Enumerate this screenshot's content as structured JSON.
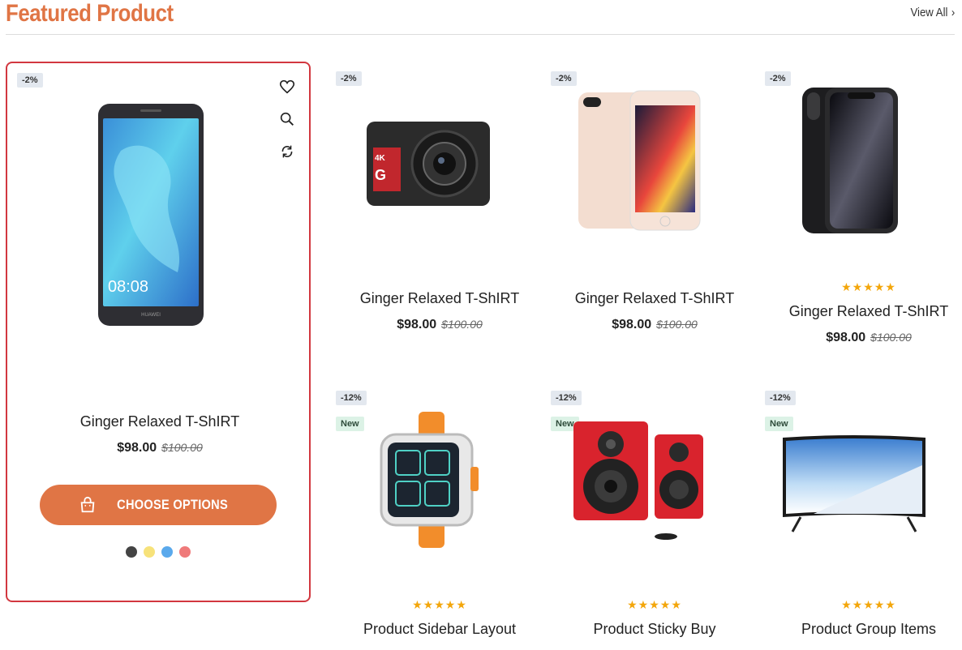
{
  "section": {
    "title": "Featured Product",
    "view_all": "View All"
  },
  "featured": {
    "badge": "-2%",
    "name": "Ginger Relaxed T-ShIRT",
    "price": "$98.00",
    "old_price": "$100.00",
    "button": "CHOOSE OPTIONS",
    "swatches": [
      "#444444",
      "#f7e27a",
      "#5aa9ec",
      "#ef7a7a"
    ],
    "phone_time": "08:08",
    "phone_brand": "HUAWEI"
  },
  "products": [
    {
      "badge": "-2%",
      "name": "Ginger Relaxed T-ShIRT",
      "price": "$98.00",
      "old_price": "$100.00",
      "image": "action-camera"
    },
    {
      "badge": "-2%",
      "name": "Ginger Relaxed T-ShIRT",
      "price": "$98.00",
      "old_price": "$100.00",
      "image": "iphone-8"
    },
    {
      "badge": "-2%",
      "name": "Ginger Relaxed T-ShIRT",
      "price": "$98.00",
      "old_price": "$100.00",
      "stars": "★★★★★",
      "image": "iphone-x"
    },
    {
      "badge": "-12%",
      "new": "New",
      "name": "Product Sidebar Layout",
      "stars": "★★★★★",
      "image": "kids-smartwatch"
    },
    {
      "badge": "-12%",
      "new": "New",
      "name": "Product Sticky Buy",
      "stars": "★★★★★",
      "image": "speakers"
    },
    {
      "badge": "-12%",
      "new": "New",
      "name": "Product Group Items",
      "stars": "★★★★★",
      "image": "curved-tv"
    }
  ],
  "colors": {
    "accent": "#e07545",
    "featured_border": "#d2373f",
    "star": "#f3a60b",
    "sale_badge_bg": "#e3e8ef",
    "new_badge_bg": "#dcf2e6"
  }
}
